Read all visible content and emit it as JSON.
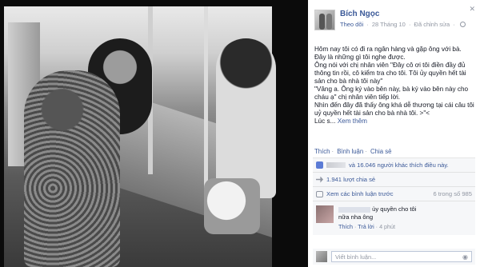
{
  "post": {
    "author": "Bích Ngọc",
    "follow": "Theo dõi",
    "date": "28 Tháng 10",
    "edited": "Đã chỉnh sửa",
    "paragraphs": [
      "Hôm nay tôi có đi ra ngân hàng và gặp ông với bà. Đây là những gì tôi nghe được.",
      "Ông nói với chị nhân viên \"Đây cô ơi tôi điền đầy đủ thông tin rồi, cô kiểm tra cho tôi. Tôi ủy quyền hết tài sản cho bà nhà tôi này\"",
      "\"Vâng a. Ông ký vào bên này, bà ký vào bên này cho cháu ạ\" chị nhân viên tiếp lời.",
      "Nhìn đến đây đã thấy ông khá dễ thương tại cái câu tôi uỷ quyền hết tài sản cho bà nhà tôi. >\"<",
      "Lúc s..."
    ],
    "see_more": "Xem thêm"
  },
  "actions": {
    "like": "Thích",
    "comment": "Bình luận",
    "share": "Chia sẻ"
  },
  "ufi": {
    "likes_text": "và 16.046 người khác thích điều này.",
    "shares_text": "1.941 lượt chia sẻ",
    "prev_comments": "Xem các bình luận trước",
    "comment_count": "6 trong số 985"
  },
  "comment": {
    "text_line1": "ủy quyền cho tôi",
    "text_line2": "nữa nha ông",
    "like": "Thích",
    "reply": "Trả lời",
    "time": "4 phút"
  },
  "composer": {
    "placeholder": "Viết bình luận..."
  },
  "icons": [
    "globe-icon",
    "like-icon",
    "share-icon",
    "comment-icon",
    "camera-icon",
    "close-icon"
  ]
}
